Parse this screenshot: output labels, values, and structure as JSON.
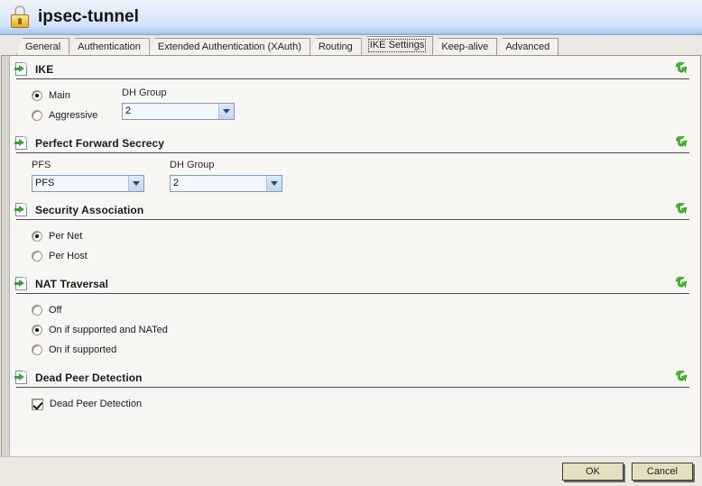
{
  "window": {
    "title": "ipsec-tunnel",
    "icon": "padlock-icon"
  },
  "tabs": [
    {
      "label": "General",
      "selected": false
    },
    {
      "label": "Authentication",
      "selected": false
    },
    {
      "label": "Extended Authentication (XAuth)",
      "selected": false
    },
    {
      "label": "Routing",
      "selected": false
    },
    {
      "label": "IKE Settings",
      "selected": true
    },
    {
      "label": "Keep-alive",
      "selected": false
    },
    {
      "label": "Advanced",
      "selected": false
    }
  ],
  "sections": {
    "ike": {
      "title": "IKE",
      "mode_options": [
        {
          "label": "Main",
          "checked": true
        },
        {
          "label": "Aggressive",
          "checked": false
        }
      ],
      "dh_group_label": "DH Group",
      "dh_group_value": "2"
    },
    "pfs": {
      "title": "Perfect Forward Secrecy",
      "pfs_label": "PFS",
      "pfs_value": "PFS",
      "dh_group_label": "DH Group",
      "dh_group_value": "2"
    },
    "security_association": {
      "title": "Security Association",
      "options": [
        {
          "label": "Per Net",
          "checked": true
        },
        {
          "label": "Per Host",
          "checked": false
        }
      ]
    },
    "nat_traversal": {
      "title": "NAT Traversal",
      "options": [
        {
          "label": "Off",
          "checked": false
        },
        {
          "label": "On if supported and NATed",
          "checked": true
        },
        {
          "label": "On if supported",
          "checked": false
        }
      ]
    },
    "dead_peer_detection": {
      "title": "Dead Peer Detection",
      "checkbox_label": "Dead Peer Detection",
      "checkbox_checked": true
    }
  },
  "reset_icon_name": "green-reset-arrow-icon",
  "buttons": {
    "ok": "OK",
    "cancel": "Cancel"
  },
  "colors": {
    "titlebar_gradient_top": "#eef4fc",
    "titlebar_gradient_bottom": "#93b7e4",
    "panel_bg": "#f7f6f3",
    "chrome_bg": "#ece9e2",
    "accent_green": "#3aa33a",
    "button_bg": "#e5dfc0",
    "select_bg": "#f2f6fd"
  }
}
